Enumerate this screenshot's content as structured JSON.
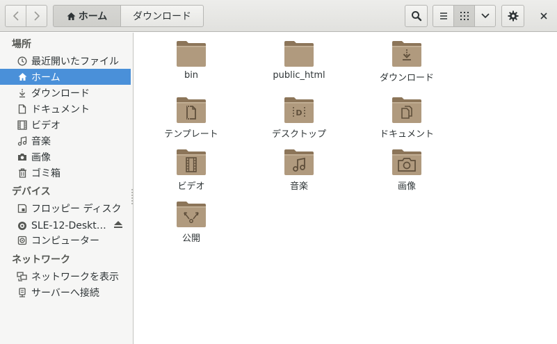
{
  "toolbar": {
    "path": [
      {
        "label": "ホーム",
        "icon": "home-icon",
        "active": true
      },
      {
        "label": "ダウンロード",
        "active": false
      }
    ]
  },
  "sidebar": {
    "sections": [
      {
        "title": "場所",
        "items": [
          {
            "label": "最近開いたファイル",
            "icon": "recent-icon"
          },
          {
            "label": "ホーム",
            "icon": "home-icon",
            "selected": true
          },
          {
            "label": "ダウンロード",
            "icon": "download-icon"
          },
          {
            "label": "ドキュメント",
            "icon": "document-icon"
          },
          {
            "label": "ビデオ",
            "icon": "video-icon"
          },
          {
            "label": "音楽",
            "icon": "music-icon"
          },
          {
            "label": "画像",
            "icon": "camera-icon"
          },
          {
            "label": "ゴミ箱",
            "icon": "trash-icon"
          }
        ]
      },
      {
        "title": "デバイス",
        "items": [
          {
            "label": "フロッピー ディスク",
            "icon": "floppy-icon"
          },
          {
            "label": "SLE-12-Deskt…",
            "icon": "disc-icon",
            "eject": true
          },
          {
            "label": "コンピューター",
            "icon": "computer-icon"
          }
        ]
      },
      {
        "title": "ネットワーク",
        "items": [
          {
            "label": "ネットワークを表示",
            "icon": "network-icon"
          },
          {
            "label": "サーバーへ接続",
            "icon": "server-icon"
          }
        ]
      }
    ]
  },
  "files": [
    {
      "name": "bin",
      "emblem": "none"
    },
    {
      "name": "public_html",
      "emblem": "none"
    },
    {
      "name": "ダウンロード",
      "emblem": "download"
    },
    {
      "name": "テンプレート",
      "emblem": "template"
    },
    {
      "name": "デスクトップ",
      "emblem": "desktop"
    },
    {
      "name": "ドキュメント",
      "emblem": "documents"
    },
    {
      "name": "ビデオ",
      "emblem": "video"
    },
    {
      "name": "音楽",
      "emblem": "music"
    },
    {
      "name": "画像",
      "emblem": "camera"
    },
    {
      "name": "公開",
      "emblem": "share"
    }
  ],
  "colors": {
    "accent": "#4a90d9",
    "folder_body": "#b09a7e",
    "folder_dark": "#8c7559",
    "emblem": "#5f4f3b"
  }
}
